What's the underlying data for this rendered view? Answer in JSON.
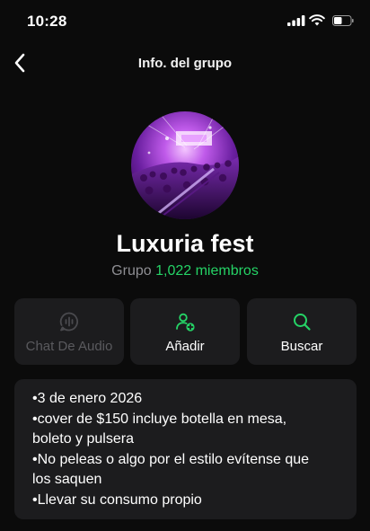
{
  "status_bar": {
    "time": "10:28",
    "icons": [
      "signal-icon",
      "wifi-icon",
      "battery-icon"
    ]
  },
  "nav": {
    "title": "Info. del grupo",
    "back_icon": "chevron-left-icon"
  },
  "group": {
    "name": "Luxuria fest",
    "type_label": "Grupo",
    "members_label": "1,022 miembros"
  },
  "actions": [
    {
      "label": "Chat De Audio",
      "icon": "audio-chat-icon",
      "enabled": false
    },
    {
      "label": "Añadir",
      "icon": "add-member-icon",
      "enabled": true
    },
    {
      "label": "Buscar",
      "icon": "search-icon",
      "enabled": true
    }
  ],
  "description": {
    "lines": [
      "•3 de enero 2026",
      "•cover de $150 incluye botella en mesa,",
      "boleto y pulsera",
      "•No peleas o algo por el estilo evítense que",
      "los saquen",
      "•Llevar su consumo propio"
    ]
  },
  "colors": {
    "background": "#0b0b0b",
    "card": "#1c1c1e",
    "accent": "#25d366",
    "secondary_text": "#8e8e93",
    "disabled_text": "#5a5a5e"
  }
}
